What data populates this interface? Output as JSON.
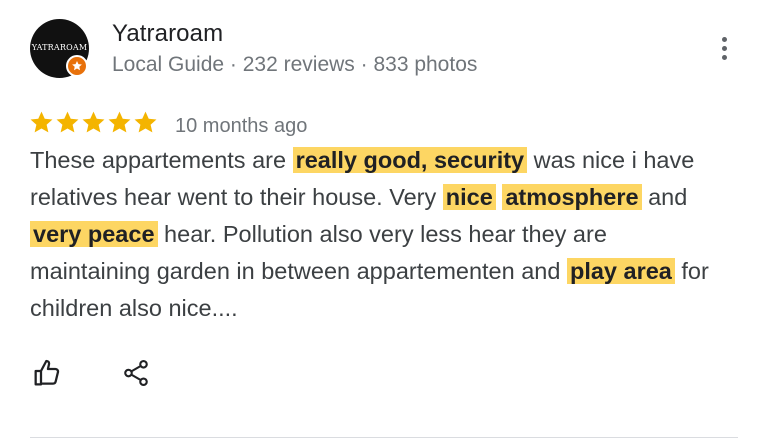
{
  "reviewer": {
    "avatar_text": "YATRAROAM",
    "name": "Yatraroam",
    "meta": "Local Guide · 232 reviews · 833 photos"
  },
  "review": {
    "rating": 5,
    "max_rating": 5,
    "time": "10 months ago",
    "segments": [
      {
        "text": "These appartements are ",
        "highlight": false
      },
      {
        "text": "really good, security",
        "highlight": true
      },
      {
        "text": " was nice i have relatives hear went to their house. Very ",
        "highlight": false
      },
      {
        "text": "nice",
        "highlight": true
      },
      {
        "text": " ",
        "highlight": false
      },
      {
        "text": "atmosphere",
        "highlight": true
      },
      {
        "text": " and ",
        "highlight": false
      },
      {
        "text": "very peace",
        "highlight": true
      },
      {
        "text": " hear. Pollution also very less hear they are maintaining garden in between appartementen and ",
        "highlight": false
      },
      {
        "text": "play area",
        "highlight": true
      },
      {
        "text": " for children also nice....",
        "highlight": false
      }
    ]
  },
  "icons": {
    "star": "star-icon",
    "like": "thumbs-up-icon",
    "share": "share-icon",
    "menu": "more-vert-icon",
    "badge": "local-guide-badge-icon"
  },
  "colors": {
    "star": "#f4b400",
    "highlight": "#fdd663",
    "badge": "#e8710a"
  }
}
